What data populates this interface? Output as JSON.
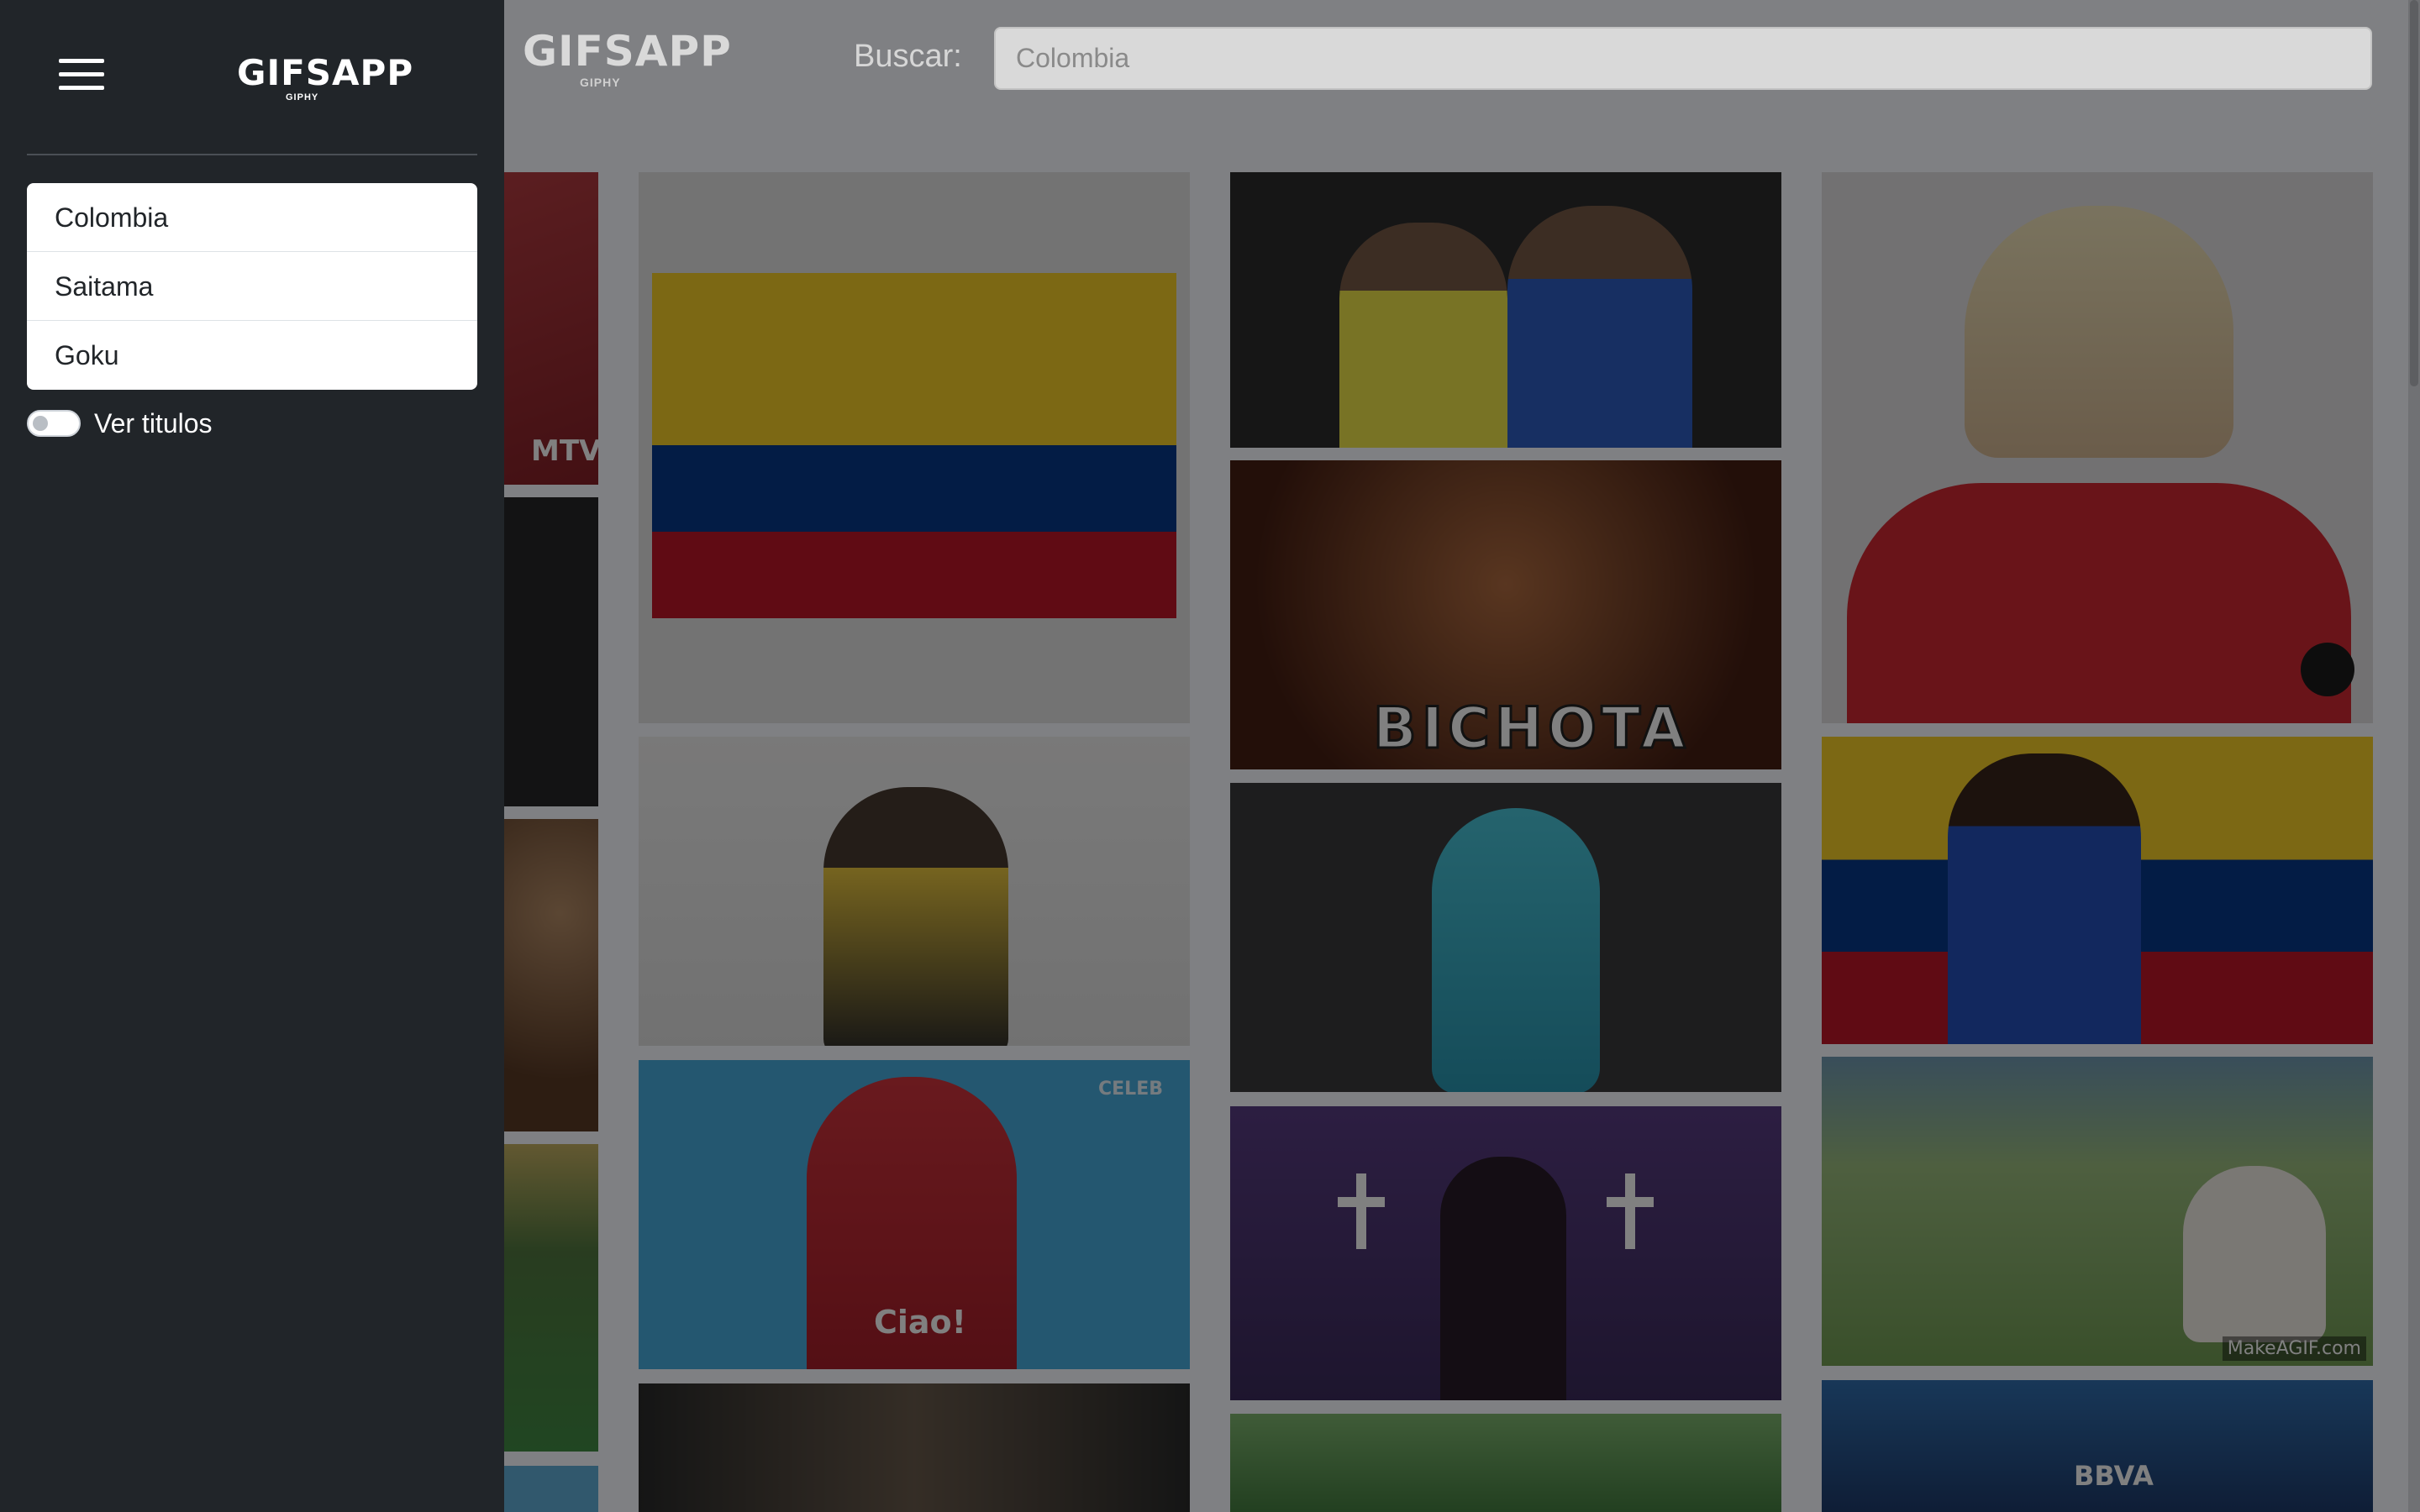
{
  "header": {
    "logo": "GIFSAPP",
    "logo_sub": "GIPHY",
    "search_label": "Buscar:",
    "search_placeholder": "Colombia"
  },
  "drawer": {
    "logo": "GIFSAPP",
    "logo_sub": "GIPHY",
    "history": [
      {
        "label": "Colombia"
      },
      {
        "label": "Saitama"
      },
      {
        "label": "Goku"
      }
    ],
    "toggle_label": "Ver titulos",
    "toggle_on": false
  },
  "gifs": {
    "bichota_caption": "BICHOTA",
    "ciao_caption": "Ciao!",
    "celeb_watermark": "CELEB",
    "makeagif_watermark": "MakeAGIF.com",
    "mtv_watermark": "MTV",
    "bbva_watermark": "BBVA"
  },
  "colors": {
    "drawer_bg": "#212529",
    "overlay_bg": "#7f8083",
    "flag_yellow": "#fcd116",
    "flag_blue": "#003893",
    "flag_red": "#ce1126"
  }
}
